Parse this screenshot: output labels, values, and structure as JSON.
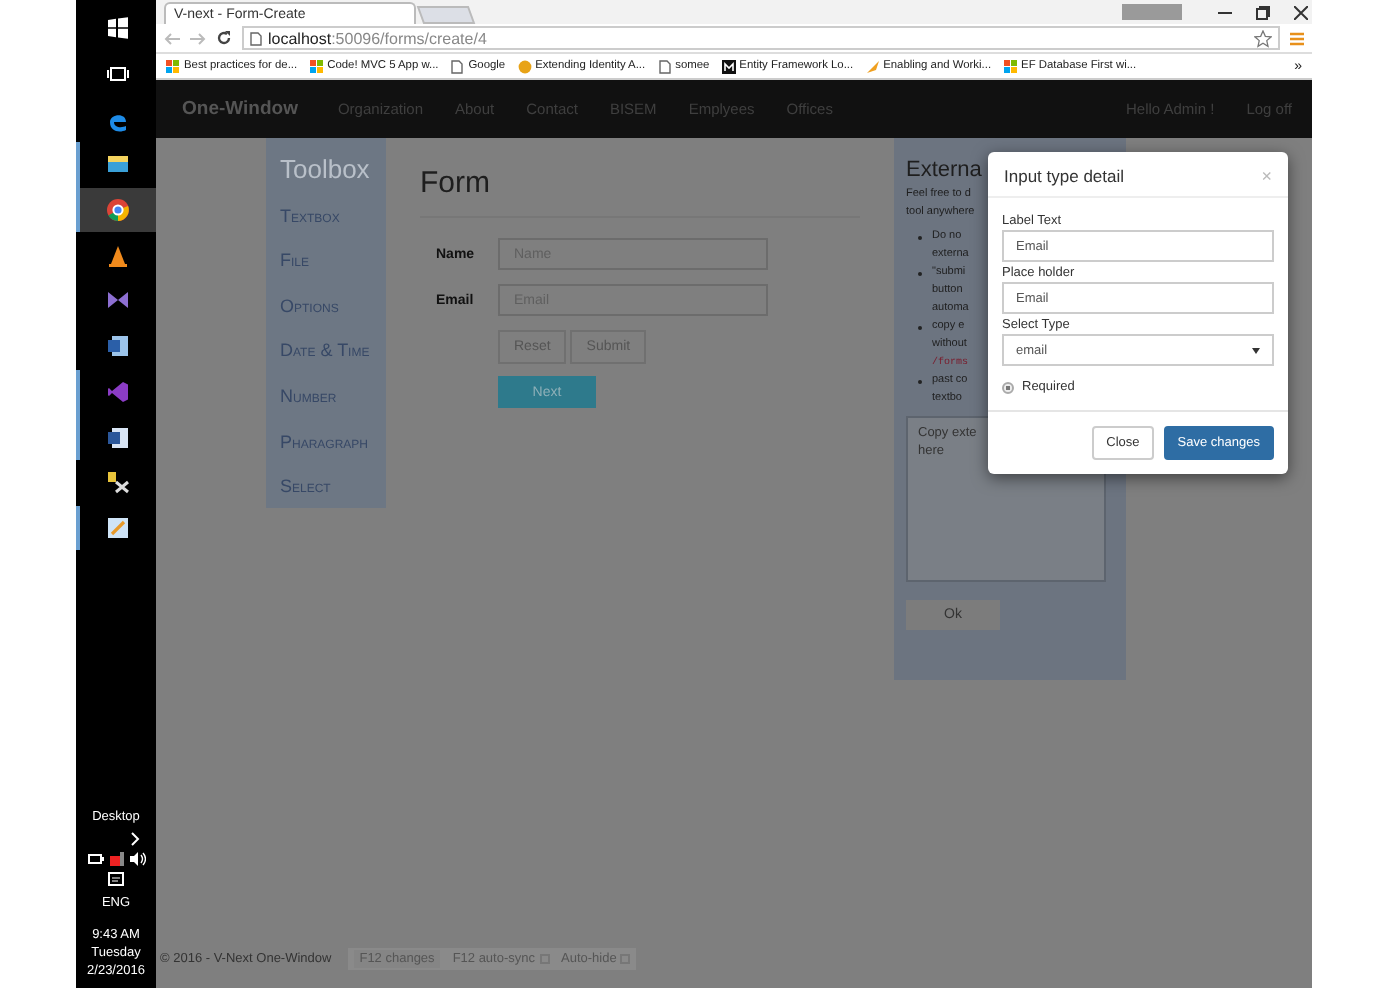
{
  "taskbar": {
    "apps": [
      {
        "kind": "start",
        "selected": false,
        "running": false
      },
      {
        "kind": "taskview",
        "selected": false,
        "running": false
      },
      {
        "kind": "edge",
        "selected": false,
        "running": false
      },
      {
        "kind": "folder",
        "selected": false,
        "running": true
      },
      {
        "kind": "chrome",
        "selected": true,
        "running": true
      },
      {
        "kind": "cone",
        "selected": false,
        "running": false
      },
      {
        "kind": "bowtie",
        "selected": false,
        "running": false
      },
      {
        "kind": "vsdoc",
        "selected": false,
        "running": false
      },
      {
        "kind": "studio",
        "selected": false,
        "running": true
      },
      {
        "kind": "word",
        "selected": false,
        "running": true
      },
      {
        "kind": "tools",
        "selected": false,
        "running": false
      },
      {
        "kind": "pen",
        "selected": false,
        "running": true
      }
    ],
    "desktop": "Desktop",
    "language": "ENG",
    "time": "9:43 AM",
    "day": "Tuesday",
    "date": "2/23/2016"
  },
  "browser": {
    "tab": {
      "title": "V-next - Form-Create",
      "selected": true
    },
    "url_host": "localhost",
    "url_path": ":50096/forms/create/4",
    "bookmarks": [
      {
        "label": "Best practices for de...",
        "kind": "windows"
      },
      {
        "label": "Code! MVC 5 App w...",
        "kind": "windows"
      },
      {
        "label": "Google",
        "kind": "page"
      },
      {
        "label": "Extending Identity A...",
        "kind": "coin"
      },
      {
        "label": "somee",
        "kind": "page"
      },
      {
        "label": "Entity Framework Lo...",
        "kind": "letter"
      },
      {
        "label": "Enabling and Worki...",
        "kind": "arrow"
      },
      {
        "label": "EF Database First wi...",
        "kind": "windows"
      }
    ],
    "more": "»"
  },
  "navbar": {
    "brand": "One-Window",
    "items": [
      "Organization",
      "About",
      "Contact",
      "BISEM",
      "Emplyees",
      "Offices"
    ],
    "right": [
      "Hello Admin !",
      "Log off"
    ]
  },
  "toolbox": {
    "title": "Toolbox",
    "items": [
      "Textbox",
      "File",
      "Options",
      "Date & Time",
      "Number",
      "Pharagraph",
      "Select"
    ]
  },
  "form": {
    "title": "Form",
    "fields": [
      {
        "label": "Name",
        "placeholder": "Name"
      },
      {
        "label": "Email",
        "placeholder": "Email"
      }
    ],
    "buttons": [
      "Reset",
      "Submit"
    ],
    "next": "Next"
  },
  "external": {
    "title": "Externa",
    "intro": [
      "Feel free to d",
      "tool anywhere"
    ],
    "bullets": [
      {
        "lines": [
          "Do no",
          "externa"
        ]
      },
      {
        "lines": [
          "\"submi",
          "button",
          "automa"
        ]
      },
      {
        "lines": [
          "copy e",
          "without"
        ],
        "code": "/forms"
      },
      {
        "lines": [
          "past co",
          "textbo"
        ]
      }
    ],
    "textarea": [
      "Copy exte",
      "here"
    ],
    "ok": "Ok"
  },
  "modal": {
    "title": "Input type detail",
    "close": "×",
    "fields": [
      {
        "label": "Label Text",
        "value": "Email",
        "kind": "text"
      },
      {
        "label": "Place holder",
        "value": "Email",
        "kind": "text"
      },
      {
        "label": "Select Type",
        "value": "email",
        "kind": "select"
      }
    ],
    "required": {
      "label": "Required",
      "checked": true
    },
    "buttons": [
      {
        "label": "Close",
        "primary": false
      },
      {
        "label": "Save changes",
        "primary": true
      }
    ]
  },
  "footer": {
    "copyright": "© 2016 - V-Next One-Window"
  },
  "devbar": [
    {
      "label": "F12 changes",
      "kind": "button"
    },
    {
      "label": "F12 auto-sync",
      "kind": "checkbox",
      "checked": false
    },
    {
      "label": "Auto-hide",
      "kind": "checkbox",
      "checked": false
    }
  ]
}
